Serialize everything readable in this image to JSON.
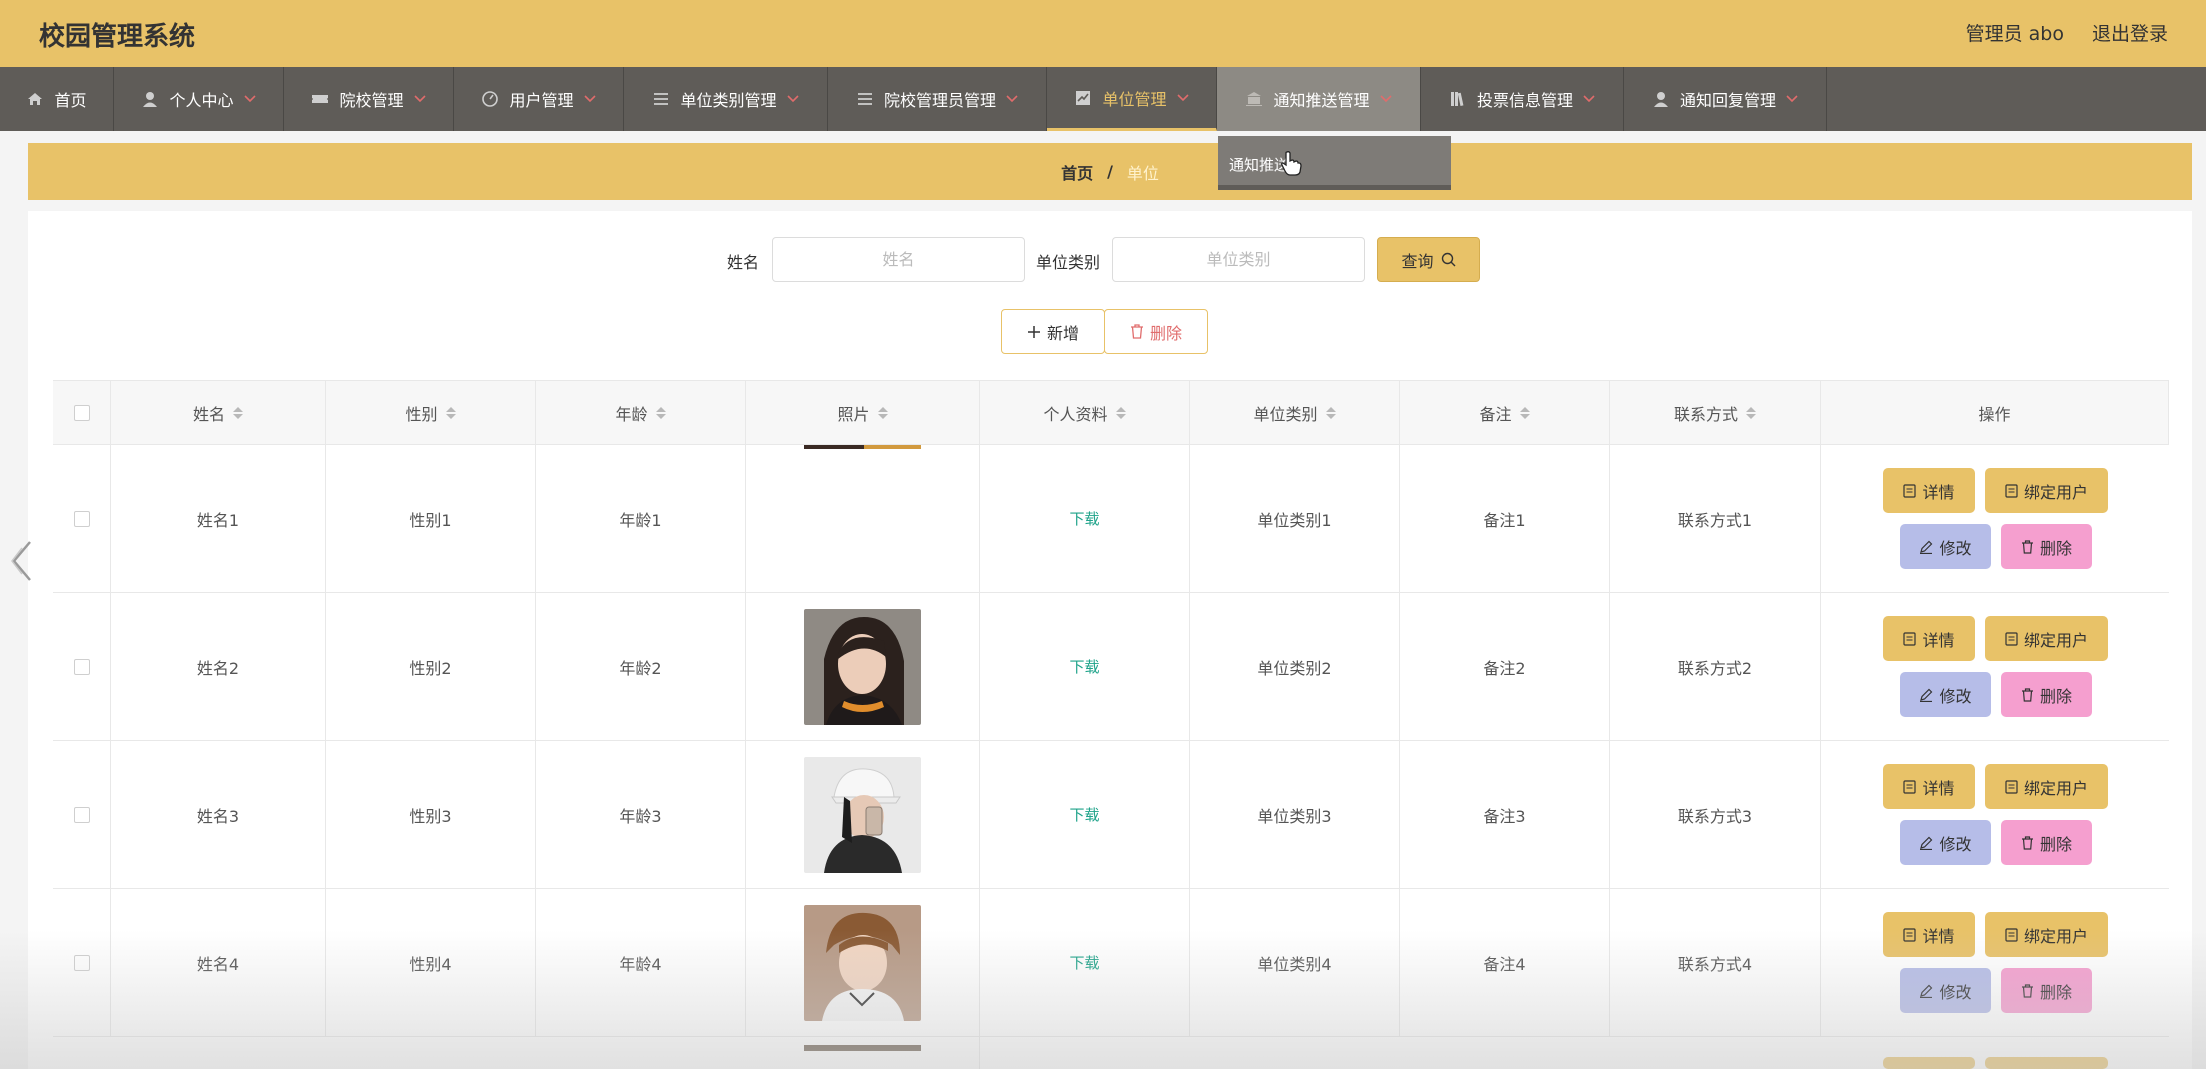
{
  "app": {
    "title": "校园管理系统",
    "user": "管理员 abo",
    "logout": "退出登录"
  },
  "nav": [
    {
      "label": "首页",
      "icon": "home-icon"
    },
    {
      "label": "个人中心",
      "icon": "user-icon"
    },
    {
      "label": "院校管理",
      "icon": "ticket-icon"
    },
    {
      "label": "用户管理",
      "icon": "gauge-icon"
    },
    {
      "label": "单位类别管理",
      "icon": "list-icon"
    },
    {
      "label": "院校管理员管理",
      "icon": "list-icon"
    },
    {
      "label": "单位管理",
      "icon": "chart-icon"
    },
    {
      "label": "通知推送管理",
      "icon": "bank-icon"
    },
    {
      "label": "投票信息管理",
      "icon": "books-icon"
    },
    {
      "label": "通知回复管理",
      "icon": "user-icon"
    }
  ],
  "dropdown": {
    "item": "通知推送"
  },
  "breadcrumb": {
    "home": "首页",
    "separator": "/",
    "current": "单位"
  },
  "search": {
    "name_label": "姓名",
    "name_placeholder": "姓名",
    "type_label": "单位类别",
    "type_placeholder": "单位类别",
    "query_label": "查询"
  },
  "actions": {
    "add_label": "新增",
    "delete_label": "删除"
  },
  "table": {
    "columns": [
      "姓名",
      "性别",
      "年龄",
      "照片",
      "个人资料",
      "单位类别",
      "备注",
      "联系方式",
      "操作"
    ],
    "rows": [
      {
        "name": "姓名1",
        "gender": "性别1",
        "age": "年龄1",
        "file": "下载",
        "type": "单位类别1",
        "note": "备注1",
        "contact": "联系方式1"
      },
      {
        "name": "姓名2",
        "gender": "性别2",
        "age": "年龄2",
        "file": "下载",
        "type": "单位类别2",
        "note": "备注2",
        "contact": "联系方式2"
      },
      {
        "name": "姓名3",
        "gender": "性别3",
        "age": "年龄3",
        "file": "下载",
        "type": "单位类别3",
        "note": "备注3",
        "contact": "联系方式3"
      },
      {
        "name": "姓名4",
        "gender": "性别4",
        "age": "年龄4",
        "file": "下载",
        "type": "单位类别4",
        "note": "备注4",
        "contact": "联系方式4"
      }
    ],
    "ops": {
      "detail": "详情",
      "bind": "绑定用户",
      "edit": "修改",
      "delete": "删除"
    }
  },
  "colors": {
    "accent": "#e8c268",
    "nav_bg": "#5f5c58",
    "edit_btn": "#b6bde8",
    "delete_btn": "#f59fcf",
    "download_link": "#1fa38a"
  }
}
